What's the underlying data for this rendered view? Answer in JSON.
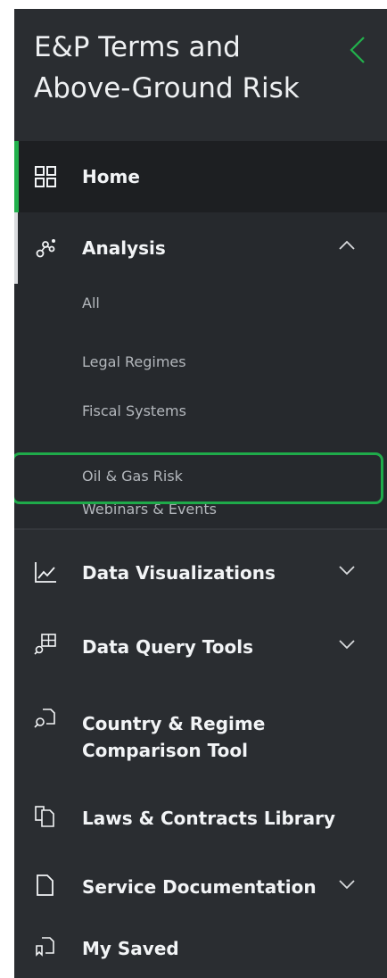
{
  "sidebar": {
    "title": "E&P Terms and Above-Ground Risk",
    "nav": {
      "home": "Home",
      "analysis": "Analysis",
      "analysis_items": [
        "All",
        "Legal Regimes",
        "Fiscal Systems",
        "Oil & Gas Risk",
        "Webinars & Events"
      ],
      "data_visualizations": "Data Visualizations",
      "data_query_tools": "Data Query Tools",
      "comparison_line1": "Country & Regime",
      "comparison_line2": "Comparison Tool",
      "laws_library": "Laws & Contracts Library",
      "service_docs": "Service Documentation",
      "my_saved": "My Saved"
    },
    "selected_item": "Oil & Gas Risk",
    "colors": {
      "background": "#2a2d31",
      "active_background": "#1d1f22",
      "accent_green": "#22b14c",
      "highlight_green": "#1faa4a"
    }
  }
}
